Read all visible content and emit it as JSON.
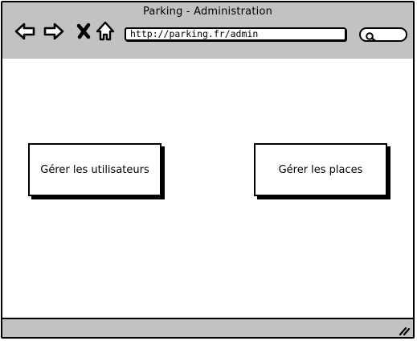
{
  "window": {
    "title": "Parking - Administration"
  },
  "toolbar": {
    "url": "http://parking.fr/admin",
    "icons": [
      "back-arrow-icon",
      "forward-arrow-icon",
      "close-x-icon",
      "home-icon",
      "search-icon"
    ]
  },
  "main": {
    "buttons": [
      {
        "label": "Gérer les utilisateurs"
      },
      {
        "label": "Gérer les places"
      }
    ]
  },
  "colors": {
    "chrome": "#c2c2c2",
    "border": "#000000",
    "background": "#ffffff"
  }
}
